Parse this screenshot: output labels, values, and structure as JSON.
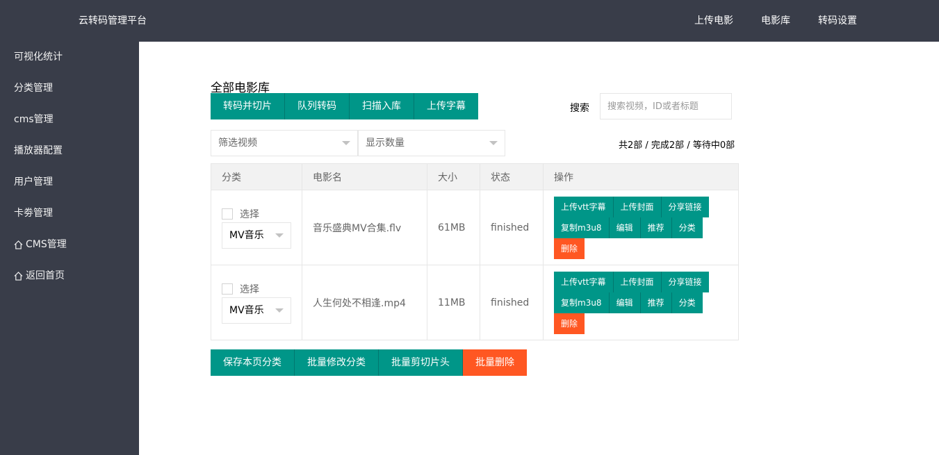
{
  "header": {
    "brand": "云转码管理平台",
    "nav": [
      "上传电影",
      "电影库",
      "转码设置"
    ]
  },
  "sidebar": {
    "items": [
      {
        "label": "可视化统计",
        "icon": ""
      },
      {
        "label": "分类管理",
        "icon": ""
      },
      {
        "label": "cms管理",
        "icon": ""
      },
      {
        "label": "播放器配置",
        "icon": ""
      },
      {
        "label": "用户管理",
        "icon": ""
      },
      {
        "label": "卡劵管理",
        "icon": ""
      },
      {
        "label": "CMS管理",
        "icon": "home-icon"
      },
      {
        "label": "返回首页",
        "icon": "home-icon"
      }
    ]
  },
  "main": {
    "title": "全部电影库",
    "toolbar": [
      "转码并切片",
      "队列转码",
      "扫描入库",
      "上传字幕"
    ],
    "search": {
      "label": "搜索",
      "placeholder": "搜索视频，ID或者标题"
    },
    "filter_select": "筛选视频",
    "count_select": "显示数量",
    "counts": "共2部 / 完成2部 / 等待中0部",
    "table": {
      "headers": [
        "分类",
        "电影名",
        "大小",
        "状态",
        "操作"
      ],
      "rows": [
        {
          "select_label": "选择",
          "category": "MV音乐",
          "name": "音乐盛典MV合集.flv",
          "size": "61MB",
          "status": "finished"
        },
        {
          "select_label": "选择",
          "category": "MV音乐",
          "name": "人生何处不相逢.mp4",
          "size": "11MB",
          "status": "finished"
        }
      ],
      "ops": {
        "row1": [
          "上传vtt字幕",
          "上传封面",
          "分享链接"
        ],
        "row2": [
          "复制m3u8",
          "编辑",
          "推荐",
          "分类"
        ],
        "delete": "删除"
      }
    },
    "bottom": [
      "保存本页分类",
      "批量修改分类",
      "批量剪切片头",
      "批量删除"
    ]
  },
  "colors": {
    "primary": "#009688",
    "danger": "#ff5722",
    "dark": "#393d49"
  }
}
